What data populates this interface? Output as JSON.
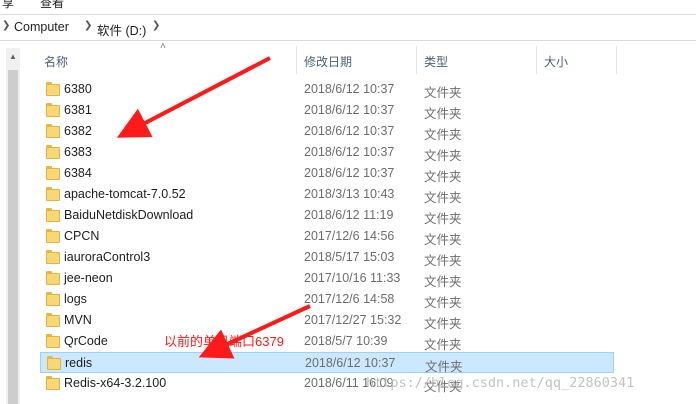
{
  "menu": {
    "item1": "享",
    "item2": "查看"
  },
  "breadcrumb": {
    "items": [
      {
        "label": "Computer"
      },
      {
        "label": "软件 (D:)"
      }
    ]
  },
  "columns": {
    "name": "名称",
    "date": "修改日期",
    "type": "类型",
    "size": "大小"
  },
  "rows": [
    {
      "name": "6380",
      "date": "2018/6/12 10:37",
      "type": "文件夹"
    },
    {
      "name": "6381",
      "date": "2018/6/12 10:37",
      "type": "文件夹"
    },
    {
      "name": "6382",
      "date": "2018/6/12 10:37",
      "type": "文件夹"
    },
    {
      "name": "6383",
      "date": "2018/6/12 10:37",
      "type": "文件夹"
    },
    {
      "name": "6384",
      "date": "2018/6/12 10:37",
      "type": "文件夹"
    },
    {
      "name": "apache-tomcat-7.0.52",
      "date": "2018/3/13 10:43",
      "type": "文件夹"
    },
    {
      "name": "BaiduNetdiskDownload",
      "date": "2018/6/12 11:19",
      "type": "文件夹"
    },
    {
      "name": "CPCN",
      "date": "2017/12/6 14:56",
      "type": "文件夹"
    },
    {
      "name": "iauroraControl3",
      "date": "2018/5/17 15:03",
      "type": "文件夹"
    },
    {
      "name": "jee-neon",
      "date": "2017/10/16 11:33",
      "type": "文件夹"
    },
    {
      "name": "logs",
      "date": "2017/12/6 14:58",
      "type": "文件夹"
    },
    {
      "name": "MVN",
      "date": "2017/12/27 15:32",
      "type": "文件夹"
    },
    {
      "name": "QrCode",
      "date": "2018/5/7 10:39",
      "type": "文件夹"
    },
    {
      "name": "redis",
      "date": "2018/6/12 10:37",
      "type": "文件夹"
    },
    {
      "name": "Redis-x64-3.2.100",
      "date": "2018/6/11 16:09",
      "type": "文件夹"
    }
  ],
  "annotation": "以前的单机端口6379",
  "watermark": "https://blog.csdn.net/qq_22860341",
  "colors": {
    "selection": "#cce8ff",
    "annotation": "#ff1a1a",
    "folder": "#f8d775"
  },
  "icons": {
    "folder": "folder-icon",
    "arrow": "chevron-right-icon",
    "sort": "sort-up-icon"
  }
}
